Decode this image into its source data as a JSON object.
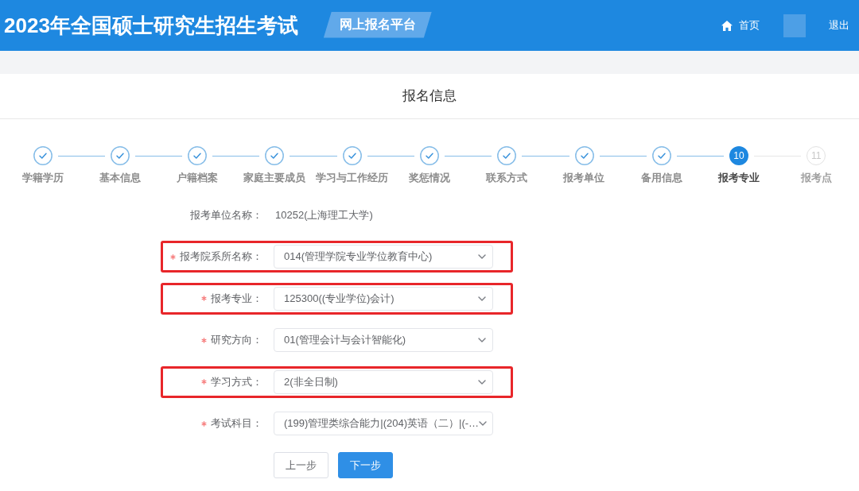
{
  "header": {
    "title": "2023年全国硕士研究生招生考试",
    "badge": "网上报名平台",
    "nav": [
      {
        "kind": "home",
        "label": "首页"
      },
      {
        "kind": "blurred"
      },
      {
        "kind": "link",
        "label": "退出"
      }
    ]
  },
  "page_title": "报名信息",
  "steps": [
    {
      "label": "学籍学历",
      "done": true,
      "selected": false
    },
    {
      "label": "基本信息",
      "done": true,
      "selected": false
    },
    {
      "label": "户籍档案",
      "done": true,
      "selected": false
    },
    {
      "label": "家庭主要成员",
      "done": true,
      "selected": false
    },
    {
      "label": "学习与工作经历",
      "done": true,
      "selected": false
    },
    {
      "label": "奖惩情况",
      "done": true,
      "selected": false
    },
    {
      "label": "联系方式",
      "done": true,
      "selected": false
    },
    {
      "label": "报考单位",
      "done": true,
      "selected": false
    },
    {
      "label": "备用信息",
      "done": true,
      "selected": false
    },
    {
      "label": "报考专业",
      "number": "10",
      "done": false,
      "selected": true
    },
    {
      "label": "报考点",
      "number": "11",
      "done": false,
      "selected": false
    }
  ],
  "fields": [
    {
      "kind": "static",
      "label": "报考单位名称：",
      "value": "10252(上海理工大学)",
      "required": false,
      "highlighted": false
    },
    {
      "kind": "select",
      "label": "报考院系所名称：",
      "value": "014(管理学院专业学位教育中心)",
      "required": true,
      "highlighted": true
    },
    {
      "kind": "select",
      "label": "报考专业：",
      "value": "125300((专业学位)会计)",
      "required": true,
      "highlighted": true
    },
    {
      "kind": "select",
      "label": "研究方向：",
      "value": "01(管理会计与会计智能化)",
      "required": true,
      "highlighted": false
    },
    {
      "kind": "select",
      "label": "学习方式：",
      "value": "2(非全日制)",
      "required": true,
      "highlighted": true
    },
    {
      "kind": "select",
      "label": "考试科目：",
      "value": "(199)管理类综合能力|(204)英语（二）|(-…",
      "required": true,
      "highlighted": false
    }
  ],
  "buttons": [
    {
      "kind": "secondary",
      "label": "上一步"
    },
    {
      "kind": "primary",
      "label": "下一步"
    }
  ]
}
